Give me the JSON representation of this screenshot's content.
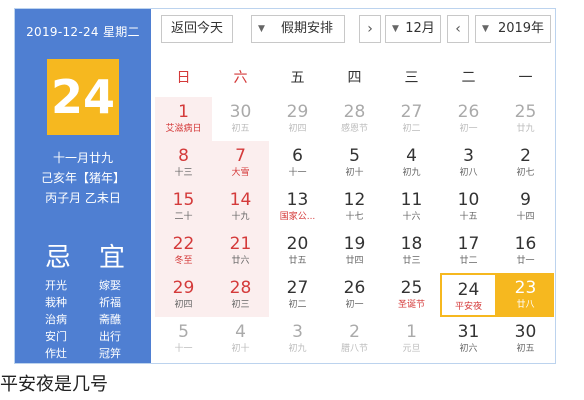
{
  "header": {
    "date_line": "2019-12-24 星期二",
    "big_day": "24",
    "lunar": [
      "十一月廿九",
      "己亥年【猪年】",
      "丙子月 乙未日"
    ]
  },
  "yiji": {
    "ji_label": "忌",
    "yi_label": "宜",
    "ji_items": [
      "开光",
      "栽种",
      "治病",
      "安门",
      "作灶"
    ],
    "yi_items": [
      "嫁娶",
      "祈福",
      "斋醮",
      "出行",
      "冠笄"
    ]
  },
  "toolbar": {
    "today_button": "返回今天",
    "holiday_select": "假期安排",
    "month_select": "12月",
    "year_select": "2019年"
  },
  "weekdays": [
    "日",
    "六",
    "五",
    "四",
    "三",
    "二",
    "一"
  ],
  "weeks": [
    [
      {
        "d": "1",
        "l": "艾滋病日"
      },
      {
        "d": "30",
        "l": "初五"
      },
      {
        "d": "29",
        "l": "初四"
      },
      {
        "d": "28",
        "l": "感恩节"
      },
      {
        "d": "27",
        "l": "初二"
      },
      {
        "d": "26",
        "l": "初一"
      },
      {
        "d": "25",
        "l": "廿九"
      }
    ],
    [
      {
        "d": "8",
        "l": "十三"
      },
      {
        "d": "7",
        "l": "大雪"
      },
      {
        "d": "6",
        "l": "十一"
      },
      {
        "d": "5",
        "l": "初十"
      },
      {
        "d": "4",
        "l": "初九"
      },
      {
        "d": "3",
        "l": "初八"
      },
      {
        "d": "2",
        "l": "初七"
      }
    ],
    [
      {
        "d": "15",
        "l": "二十"
      },
      {
        "d": "14",
        "l": "十九"
      },
      {
        "d": "13",
        "l": "国家公..."
      },
      {
        "d": "12",
        "l": "十七"
      },
      {
        "d": "11",
        "l": "十六"
      },
      {
        "d": "10",
        "l": "十五"
      },
      {
        "d": "9",
        "l": "十四"
      }
    ],
    [
      {
        "d": "22",
        "l": "冬至"
      },
      {
        "d": "21",
        "l": "廿六"
      },
      {
        "d": "20",
        "l": "廿五"
      },
      {
        "d": "19",
        "l": "廿四"
      },
      {
        "d": "18",
        "l": "廿三"
      },
      {
        "d": "17",
        "l": "廿二"
      },
      {
        "d": "16",
        "l": "廿一"
      }
    ],
    [
      {
        "d": "29",
        "l": "初四"
      },
      {
        "d": "28",
        "l": "初三"
      },
      {
        "d": "27",
        "l": "初二"
      },
      {
        "d": "26",
        "l": "初一"
      },
      {
        "d": "25",
        "l": "圣诞节"
      },
      {
        "d": "24",
        "l": "平安夜"
      },
      {
        "d": "23",
        "l": "廿八"
      }
    ],
    [
      {
        "d": "5",
        "l": "十一"
      },
      {
        "d": "4",
        "l": "初十"
      },
      {
        "d": "3",
        "l": "初九"
      },
      {
        "d": "2",
        "l": "腊八节"
      },
      {
        "d": "1",
        "l": "元旦"
      },
      {
        "d": "31",
        "l": "初六"
      },
      {
        "d": "30",
        "l": "初五"
      }
    ]
  ],
  "caption": "平安夜是几号"
}
